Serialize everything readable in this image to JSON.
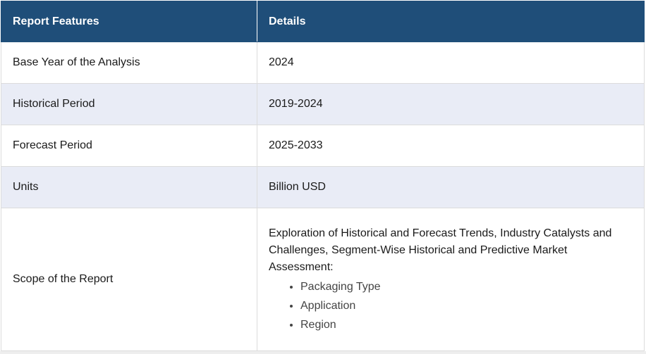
{
  "table": {
    "headers": [
      "Report Features",
      "Details"
    ],
    "rows": [
      {
        "feature": "Base Year of the Analysis",
        "detail": "2024"
      },
      {
        "feature": "Historical Period",
        "detail": "2019-2024"
      },
      {
        "feature": "Forecast Period",
        "detail": "2025-2033"
      },
      {
        "feature": "Units",
        "detail": "Billion USD"
      }
    ],
    "scope": {
      "feature": "Scope of the Report",
      "text": "Exploration of Historical and Forecast Trends, Industry Catalysts and Challenges, Segment-Wise Historical and Predictive Market Assessment:",
      "items": [
        "Packaging Type",
        "Application",
        "Region"
      ]
    }
  },
  "colors": {
    "header_bg": "#1f4e79",
    "header_text": "#ffffff",
    "alt_row_bg": "#e9ecf6"
  }
}
